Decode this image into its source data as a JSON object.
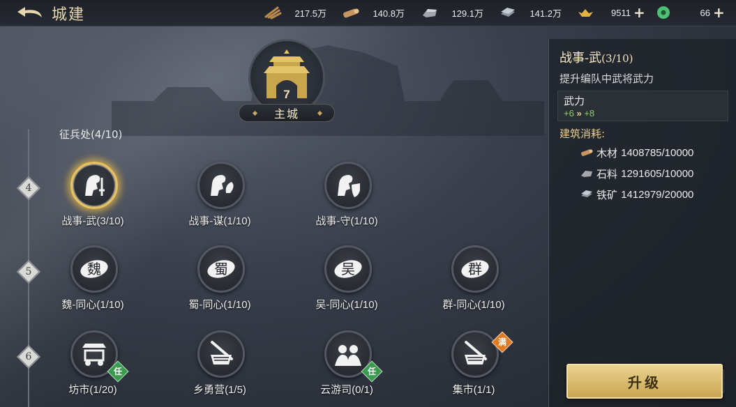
{
  "header": {
    "title": "城建",
    "resources": [
      {
        "name": "wood",
        "icon": "wood-icon",
        "value": "217.5万",
        "color": "#b98b4f"
      },
      {
        "name": "lumber",
        "icon": "lumber-icon",
        "value": "140.8万",
        "color": "#c79560"
      },
      {
        "name": "stone",
        "icon": "stone-icon",
        "value": "129.1万",
        "color": "#a3a7ad"
      },
      {
        "name": "iron",
        "icon": "iron-icon",
        "value": "141.2万",
        "color": "#8e98a3"
      },
      {
        "name": "gold",
        "icon": "gold-ingot-icon",
        "value": "9511",
        "color": "#e3b440"
      },
      {
        "name": "jade",
        "icon": "jade-coin-icon",
        "value": "66",
        "color": "#4fbf74"
      }
    ]
  },
  "main_city": {
    "level": "7",
    "name": "主城"
  },
  "section": {
    "label": "征兵处(4/10)"
  },
  "tiers": [
    "4",
    "5",
    "6"
  ],
  "buildings": [
    {
      "label": "战事-武(3/10)",
      "icon": "warrior-sword-icon"
    },
    {
      "label": "战事-谋(1/10)",
      "icon": "strategist-fan-icon"
    },
    {
      "label": "战事-守(1/10)",
      "icon": "guardian-shield-icon"
    },
    {
      "label": "魏-同心(1/10)",
      "icon": "wei-emblem-icon",
      "glyph": "魏"
    },
    {
      "label": "蜀-同心(1/10)",
      "icon": "shu-emblem-icon",
      "glyph": "蜀"
    },
    {
      "label": "吴-同心(1/10)",
      "icon": "wu-emblem-icon",
      "glyph": "吴"
    },
    {
      "label": "群-同心(1/10)",
      "icon": "qun-emblem-icon",
      "glyph": "群"
    },
    {
      "label": "坊市(1/20)",
      "icon": "market-stall-icon",
      "badge": "任"
    },
    {
      "label": "乡勇营(1/5)",
      "icon": "militia-camp-icon"
    },
    {
      "label": "云游司(0/1)",
      "icon": "travelers-icon",
      "badge": "任"
    },
    {
      "label": "集市(1/1)",
      "icon": "bazaar-icon",
      "badge": "满"
    }
  ],
  "panel": {
    "title": "战事-武",
    "title_count": "(3/10)",
    "description": "提升编队中武将武力",
    "stat": {
      "name": "武力",
      "from": "+6",
      "to": "+8"
    },
    "cost_header": "建筑消耗:",
    "costs": [
      {
        "name": "木材",
        "value": "1408785/10000",
        "icon": "wood-icon"
      },
      {
        "name": "石料",
        "value": "1291605/10000",
        "icon": "stone-icon"
      },
      {
        "name": "铁矿",
        "value": "1412979/20000",
        "icon": "iron-icon"
      }
    ]
  },
  "upgrade_button": {
    "label": "升级"
  },
  "colors": {
    "accent_gold": "#e9c15f",
    "badge_green": "#3a9b4f",
    "badge_orange": "#e07b24",
    "stat_green": "#8bd36a"
  }
}
